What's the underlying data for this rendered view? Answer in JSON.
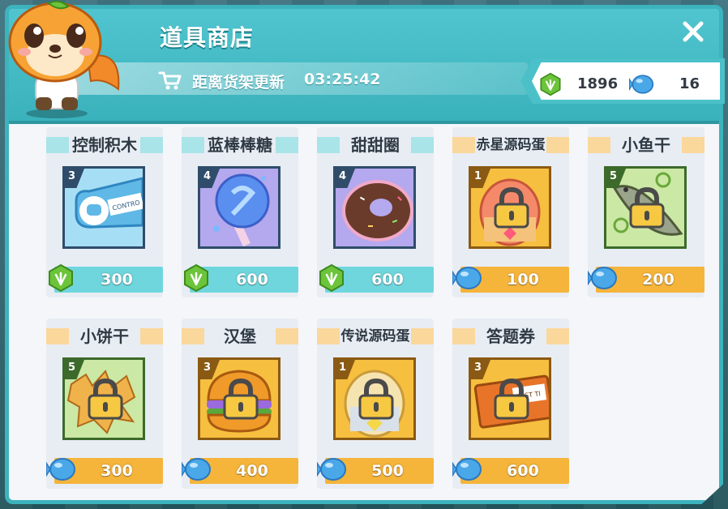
{
  "title": "道具商店",
  "timer": {
    "label": "距离货架更新",
    "value": "03:25:42"
  },
  "currency": {
    "gems": "1896",
    "candies": "16"
  },
  "colors": {
    "teal": "#3cb3bd",
    "teal_price": "#6fd6dd",
    "orange_price": "#f5b43a",
    "gem": "#6cc43a",
    "candy": "#4aa8e8",
    "bar_teal": "#a9e4e8",
    "bar_orange": "#fad79b"
  },
  "items": [
    {
      "name": "控制积木",
      "count": "3",
      "price": "300",
      "currency": "gem-icon",
      "locked": false,
      "art": "controller-block"
    },
    {
      "name": "蓝棒棒糖",
      "count": "4",
      "price": "600",
      "currency": "gem-icon",
      "locked": false,
      "art": "blue-lollipop"
    },
    {
      "name": "甜甜圈",
      "count": "4",
      "price": "600",
      "currency": "gem-icon",
      "locked": false,
      "art": "donut"
    },
    {
      "name": "赤星源码蛋",
      "count": "1",
      "price": "100",
      "currency": "candy-icon",
      "locked": true,
      "art": "red-egg"
    },
    {
      "name": "小鱼干",
      "count": "5",
      "price": "200",
      "currency": "candy-icon",
      "locked": true,
      "art": "dried-fish"
    },
    {
      "name": "小饼干",
      "count": "5",
      "price": "300",
      "currency": "candy-icon",
      "locked": true,
      "art": "cookies"
    },
    {
      "name": "汉堡",
      "count": "3",
      "price": "400",
      "currency": "candy-icon",
      "locked": true,
      "art": "burger"
    },
    {
      "name": "传说源码蛋",
      "count": "1",
      "price": "500",
      "currency": "candy-icon",
      "locked": true,
      "art": "legend-egg"
    },
    {
      "name": "答题券",
      "count": "3",
      "price": "600",
      "currency": "candy-icon",
      "locked": true,
      "art": "quiz-ticket"
    }
  ]
}
